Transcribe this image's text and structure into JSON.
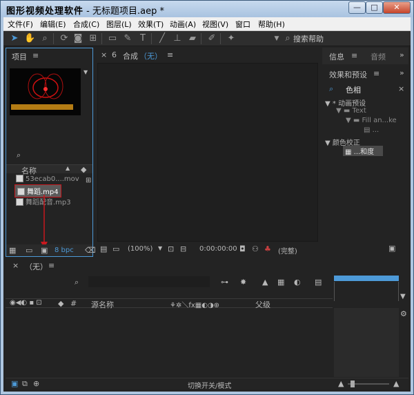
{
  "window": {
    "app_title": "图形视频处理软件",
    "doc_title": " - 无标题项目.aep *",
    "min_label": "—",
    "max_label": "□",
    "close_label": "✕"
  },
  "menu": [
    "文件(F)",
    "编辑(E)",
    "合成(C)",
    "图层(L)",
    "效果(T)",
    "动画(A)",
    "视图(V)",
    "窗口",
    "帮助(H)"
  ],
  "toolbar": {
    "help_search": "搜索帮助"
  },
  "project": {
    "tab": "项目",
    "column_name": "名称",
    "items": [
      {
        "name": "53ecab0....mov",
        "selected": false
      },
      {
        "name": "舞蹈.mp4",
        "selected": true
      },
      {
        "name": "舞蹈配音.mp3",
        "selected": false
      }
    ],
    "bpc": "8 bpc"
  },
  "composition": {
    "tab": "合成",
    "tab_value": "（无）",
    "zoom": "(100%)",
    "timecode": "0:00:00:00",
    "quality": "(完整)"
  },
  "info": {
    "tab1": "信息",
    "tab2": "音频"
  },
  "effects": {
    "tab": "效果和预设",
    "search_value": "色相",
    "tree": [
      {
        "label": "* 动画预设",
        "indent": 0
      },
      {
        "label": "Text",
        "indent": 1
      },
      {
        "label": "Fill an...ke",
        "indent": 2
      },
      {
        "label": "...",
        "indent": 3
      },
      {
        "label": "颜色校正",
        "indent": 0
      },
      {
        "label": "...和度",
        "indent": 1
      }
    ]
  },
  "timeline": {
    "tab": "（无）",
    "col_hash": "#",
    "col_source": "源名称",
    "col_parent": "父级",
    "footer": "切换开关/模式"
  },
  "colors": {
    "accent": "#4d9ad8",
    "selection": "#c8181e"
  }
}
